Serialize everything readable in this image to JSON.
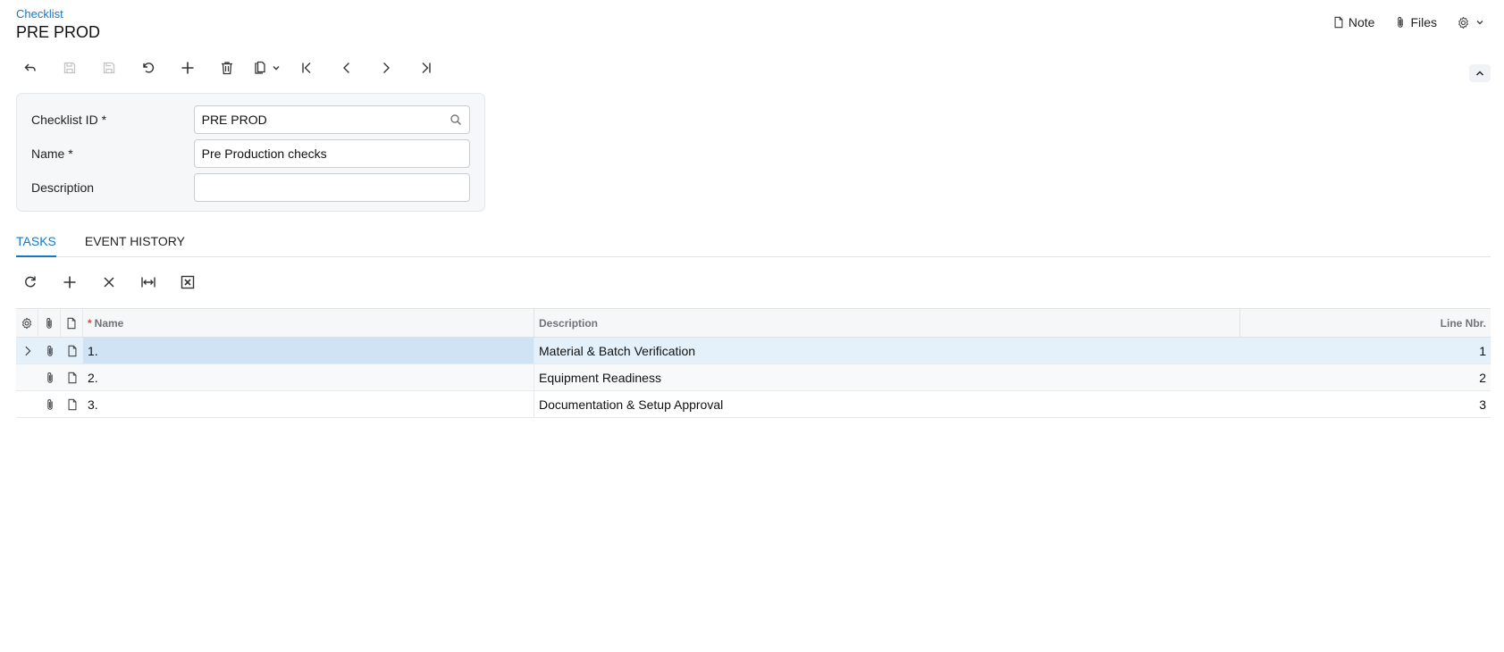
{
  "breadcrumb": "Checklist",
  "page_title": "PRE PROD",
  "top_actions": {
    "note": "Note",
    "files": "Files"
  },
  "icons": {
    "toolbar": [
      "back-icon",
      "save-close-icon",
      "save-icon",
      "undo-icon",
      "add-icon",
      "delete-icon",
      "clipboard-icon",
      "first-record-icon",
      "previous-record-icon",
      "next-record-icon",
      "last-record-icon"
    ],
    "grid_toolbar": [
      "refresh-icon",
      "add-row-icon",
      "delete-row-icon",
      "fit-columns-icon",
      "export-excel-icon"
    ]
  },
  "form": {
    "checklist_id": {
      "label": "Checklist ID",
      "required_mark": "*",
      "value": "PRE PROD"
    },
    "name": {
      "label": "Name",
      "required_mark": "*",
      "value": "Pre Production checks"
    },
    "description": {
      "label": "Description",
      "value": ""
    }
  },
  "tabs": [
    {
      "label": "TASKS",
      "active": true
    },
    {
      "label": "EVENT HISTORY",
      "active": false
    }
  ],
  "grid": {
    "columns": {
      "name_required": "*",
      "name": "Name",
      "description": "Description",
      "line_nbr": "Line Nbr."
    },
    "rows": [
      {
        "name": "1.",
        "description": "Material & Batch Verification",
        "line_nbr": "1",
        "selected": true
      },
      {
        "name": "2.",
        "description": "Equipment Readiness",
        "line_nbr": "2",
        "selected": false
      },
      {
        "name": "3.",
        "description": "Documentation & Setup Approval",
        "line_nbr": "3",
        "selected": false
      }
    ]
  },
  "colors": {
    "accent": "#1377c9",
    "selected_row": "#e4f0fa",
    "selected_cell": "#cfe3f5",
    "panel": "#f6f7f9"
  }
}
